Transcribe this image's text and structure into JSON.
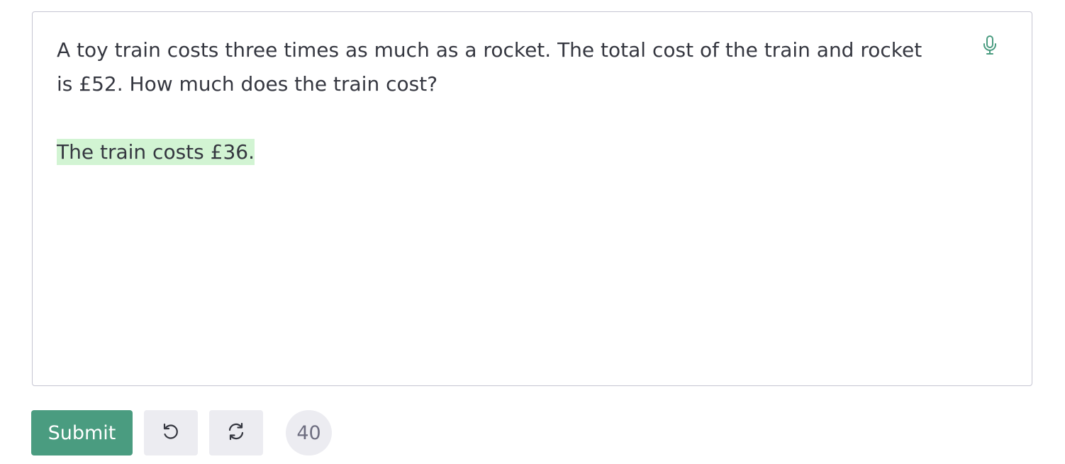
{
  "editor": {
    "prompt_line_1": "A toy train costs three times as much as a rocket. The total cost of the train and rocket",
    "prompt_line_2": "is £52. How much does the train cost?",
    "completion": "The train costs £36."
  },
  "icons": {
    "mic": "microphone-icon",
    "undo": "undo-icon",
    "regenerate": "regenerate-icon"
  },
  "toolbar": {
    "submit_label": "Submit",
    "token_count": "40"
  },
  "colors": {
    "accent": "#4a9c80",
    "highlight": "#d2f4d3",
    "button_bg": "#ececf1",
    "text": "#353740"
  }
}
